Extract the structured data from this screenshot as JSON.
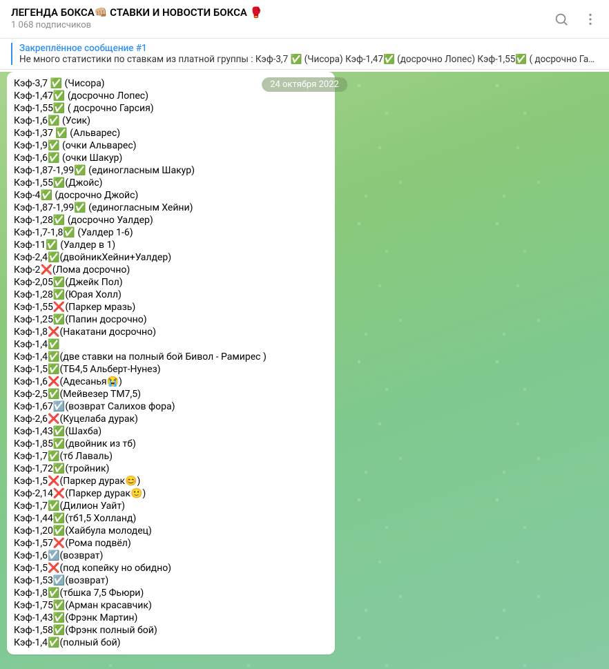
{
  "header": {
    "title": "ЛЕГЕНДА БОКСА👊🏼 СТАВКИ И НОВОСТИ БОКСА 🥊",
    "subtitle": "1 068 подписчиков"
  },
  "pinned": {
    "title": "Закреплённое сообщение #1",
    "text": "Не много статистики по ставкам из платной группы :  Кэф-3,7 ✅ (Чисора) Кэф-1,47✅ (досрочно Лопес) Кэф-1,55✅ ( досрочно Гарсия) …"
  },
  "date_label": "24 октября 2022",
  "status_icons": {
    "check": "✅",
    "cross": "❌",
    "neutral": "☑️",
    "sad": "😭",
    "blush": "😊",
    "smirk": "🙂"
  },
  "lines": [
    {
      "prefix": "Кэф-3,7 ",
      "status": "check",
      "desc": " (Чисора)"
    },
    {
      "prefix": "Кэф-1,47",
      "status": "check",
      "desc": " (досрочно Лопес)"
    },
    {
      "prefix": "Кэф-1,55",
      "status": "check",
      "desc": " ( досрочно Гарсия)"
    },
    {
      "prefix": "Кэф-1,6",
      "status": "check",
      "desc": " (Усик)"
    },
    {
      "prefix": "Кэф-1,37 ",
      "status": "check",
      "desc": " (Альварес)"
    },
    {
      "prefix": "Кэф-1,9",
      "status": "check",
      "desc": " (очки Альварес)"
    },
    {
      "prefix": "Кэф-1,6",
      "status": "check",
      "desc": " (очки Шакур)"
    },
    {
      "prefix": "Кэф-1,87-1,99",
      "status": "check",
      "desc": " (единогласным Шакур)"
    },
    {
      "prefix": "Кэф-1,55",
      "status": "check",
      "desc": "(Джойс)"
    },
    {
      "prefix": "Кэф-4",
      "status": "check",
      "desc": " (досрочно Джойс)"
    },
    {
      "prefix": "Кэф-1,87-1,99",
      "status": "check",
      "desc": " (единогласным Хейни)"
    },
    {
      "prefix": "Кэф-1,28",
      "status": "check",
      "desc": " (досрочно Уалдер)"
    },
    {
      "prefix": "Кэф-1,7-1,8",
      "status": "check",
      "desc": " (Уалдер 1-6)"
    },
    {
      "prefix": "Кэф-11",
      "status": "check",
      "desc": " (Уалдер в 1)"
    },
    {
      "prefix": "Кэф-2,4",
      "status": "check",
      "desc": "(двойникХейни+Уалдер)"
    },
    {
      "prefix": "Кэф-2",
      "status": "cross",
      "desc": "(Лома досрочно)"
    },
    {
      "prefix": "Кэф-2,05",
      "status": "check",
      "desc": "(Джейк Пол)"
    },
    {
      "prefix": "Кэф-1,28",
      "status": "check",
      "desc": "(Юрая Холл)"
    },
    {
      "prefix": "Кэф-1,55",
      "status": "cross",
      "desc": "(Паркер мразь)"
    },
    {
      "prefix": "Кэф-1,25",
      "status": "check",
      "desc": "(Папин досрочно)"
    },
    {
      "prefix": "Кэф-1,8",
      "status": "cross",
      "desc": "(Накатани досрочно)"
    },
    {
      "prefix": "Кэф-1,4",
      "status": "check",
      "desc": ""
    },
    {
      "prefix": "Кэф-1,4",
      "status": "check",
      "desc": "(две ставки на полный бой Бивол - Рамирес )"
    },
    {
      "prefix": "Кэф-1,5",
      "status": "check",
      "desc": "(ТБ4,5 Альберт-Нунез)"
    },
    {
      "prefix": "Кэф-1,6",
      "status": "cross",
      "desc": "(Адесанья",
      "extra": "sad",
      "tail": ")"
    },
    {
      "prefix": "Кэф-2,5",
      "status": "check",
      "desc": "(Мейвезер ТМ7,5)"
    },
    {
      "prefix": "Кэф-1,67",
      "status": "neutral",
      "desc": "(возврат Салихов фора)"
    },
    {
      "prefix": "Кэф-2,6",
      "status": "cross",
      "desc": "(Куцелаба дурак)"
    },
    {
      "prefix": "Кэф-1,43",
      "status": "check",
      "desc": "(Шахба)"
    },
    {
      "prefix": "Кэф-1,85",
      "status": "check",
      "desc": "(двойник из тб)"
    },
    {
      "prefix": "Кэф-1,7",
      "status": "check",
      "desc": "(тб Лаваль)"
    },
    {
      "prefix": "Кэф-1,72",
      "status": "check",
      "desc": "(тройник)"
    },
    {
      "prefix": "Кэф-1,5",
      "status": "cross",
      "desc": "(Паркер дурак",
      "extra": "blush",
      "tail": ")"
    },
    {
      "prefix": "Кэф-2,14",
      "status": "cross",
      "desc": "(Паркер дурак",
      "extra": "smirk",
      "tail": ")"
    },
    {
      "prefix": "Кэф-1,7",
      "status": "check",
      "desc": "(Дилион Уайт)"
    },
    {
      "prefix": "Кэф-1,44",
      "status": "check",
      "desc": "(тб1,5 Холланд)"
    },
    {
      "prefix": "Кэф-1,20",
      "status": "check",
      "desc": "(Хайбула молодец)"
    },
    {
      "prefix": "Кэф-1,57",
      "status": "cross",
      "desc": "(Рома подвёл)"
    },
    {
      "prefix": "Кэф-1,6",
      "status": "neutral",
      "desc": "(возврат)"
    },
    {
      "prefix": "Кэф-1,5",
      "status": "cross",
      "desc": "(под копейку но обидно)"
    },
    {
      "prefix": "Кэф-1,53",
      "status": "neutral",
      "desc": "(возврат)"
    },
    {
      "prefix": "Кэф-1,8",
      "status": "check",
      "desc": "(тбшка 7,5 Фьюри)"
    },
    {
      "prefix": "Кэф-1,75",
      "status": "check",
      "desc": "(Арман красавчик)"
    },
    {
      "prefix": "Кэф-1,43",
      "status": "check",
      "desc": "(Фрэнк Мартин)"
    },
    {
      "prefix": "Кэф-1,58",
      "status": "check",
      "desc": "(Фрэнк полный бой)"
    },
    {
      "prefix": "Кэф-1,4",
      "status": "check",
      "desc": "(полный бой)"
    }
  ]
}
